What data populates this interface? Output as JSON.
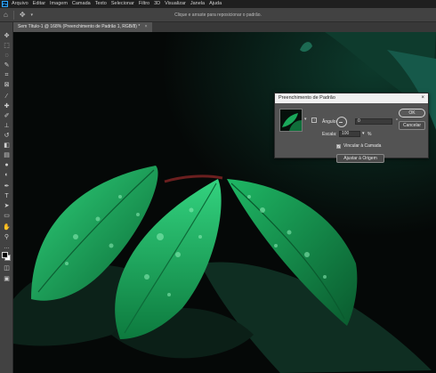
{
  "app": {
    "logo": "Ps"
  },
  "menu": [
    "Arquivo",
    "Editar",
    "Imagem",
    "Camada",
    "Texto",
    "Selecionar",
    "Filtro",
    "3D",
    "Visualizar",
    "Janela",
    "Ajuda"
  ],
  "options_bar": {
    "hint": "Clique e arraste para reposicionar o padrão."
  },
  "document_tab": {
    "title": "Sem Título-1 @ 168% (Preenchimento de Padrão 1, RGB/8) *",
    "close": "×"
  },
  "dialog": {
    "title": "Preenchimento de Padrão",
    "close": "×",
    "angle_label": "Ângulo:",
    "angle_value": "0",
    "angle_unit": "°",
    "scale_label": "Escala:",
    "scale_value": "100",
    "scale_unit": "%",
    "link_label": "Vincular à Camada",
    "link_checked": true,
    "snap_button": "Ajustar à Origem",
    "ok_button": "OK",
    "cancel_button": "Cancelar"
  },
  "colors": {
    "foreground": "#000000",
    "background": "#ffffff",
    "leaf": "#1aa85a"
  },
  "icons": {
    "tools": [
      "move-icon",
      "marquee-icon",
      "lasso-icon",
      "quick-select-icon",
      "crop-icon",
      "frame-icon",
      "eyedropper-icon",
      "healing-icon",
      "brush-icon",
      "stamp-icon",
      "history-brush-icon",
      "eraser-icon",
      "gradient-icon",
      "blur-icon",
      "dodge-icon",
      "pen-icon",
      "type-icon",
      "path-select-icon",
      "rectangle-icon",
      "hand-icon",
      "zoom-icon",
      "more-icon"
    ]
  }
}
